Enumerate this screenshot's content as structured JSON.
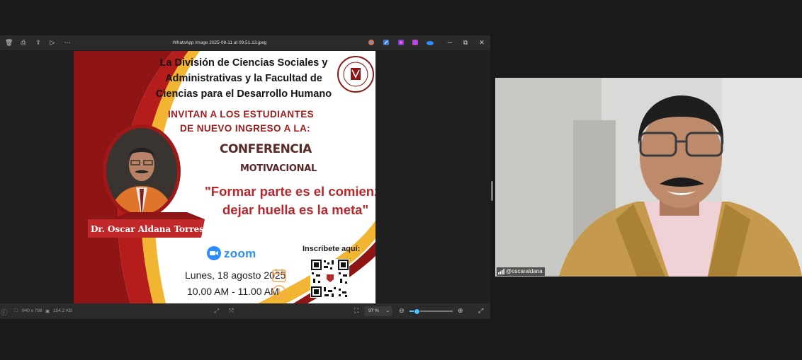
{
  "viewer": {
    "window_title": "WhatsApp Image 2025-08-11 at 09.51.13.jpeg",
    "toolbar_icons": [
      "delete-icon",
      "print-icon",
      "share-icon",
      "slideshow-icon",
      "more-icon"
    ],
    "app_icons": [
      "copilot-icon",
      "edit-icon",
      "clipchamp-icon",
      "designer-icon",
      "onedrive-icon"
    ],
    "window_controls": {
      "minimize": "─",
      "restore": "⧉",
      "close": "✕"
    }
  },
  "flyer": {
    "header": "La División de Ciencias Sociales y Administrativas  y la  Facultad de Ciencias para el Desarrollo Humano",
    "invite_line1": "INVITAN A LOS ESTUDIANTES",
    "invite_line2": "DE NUEVO INGRESO A LA:",
    "conference": "CONFERENCIA",
    "motivational": "MOTIVACIONAL",
    "quote_line1": "\"Formar parte es el comienzo,",
    "quote_line2": "dejar huella es la meta\"",
    "speaker": "Dr. Oscar Aldana Torres",
    "platform": "zoom",
    "date": "Lunes, 18 agosto 2025",
    "time": "10.00 AM - 11.00 AM",
    "register": "Inscríbete aquí:",
    "seal_label": "UNIVERSIDAD AUTÓNOMA DE TLAXCALA"
  },
  "status": {
    "dimensions": "940 x 788",
    "size": "154.2 KB",
    "zoom_level": "97 %",
    "zoom_fraction": 0.16
  },
  "webcam": {
    "name_tag": "@oscaraldana"
  },
  "colors": {
    "maroon": "#8f1414",
    "crimson": "#b8262b",
    "gold": "#f2b531",
    "zoom_blue": "#2d8cff",
    "viewer_bg": "#202020"
  }
}
